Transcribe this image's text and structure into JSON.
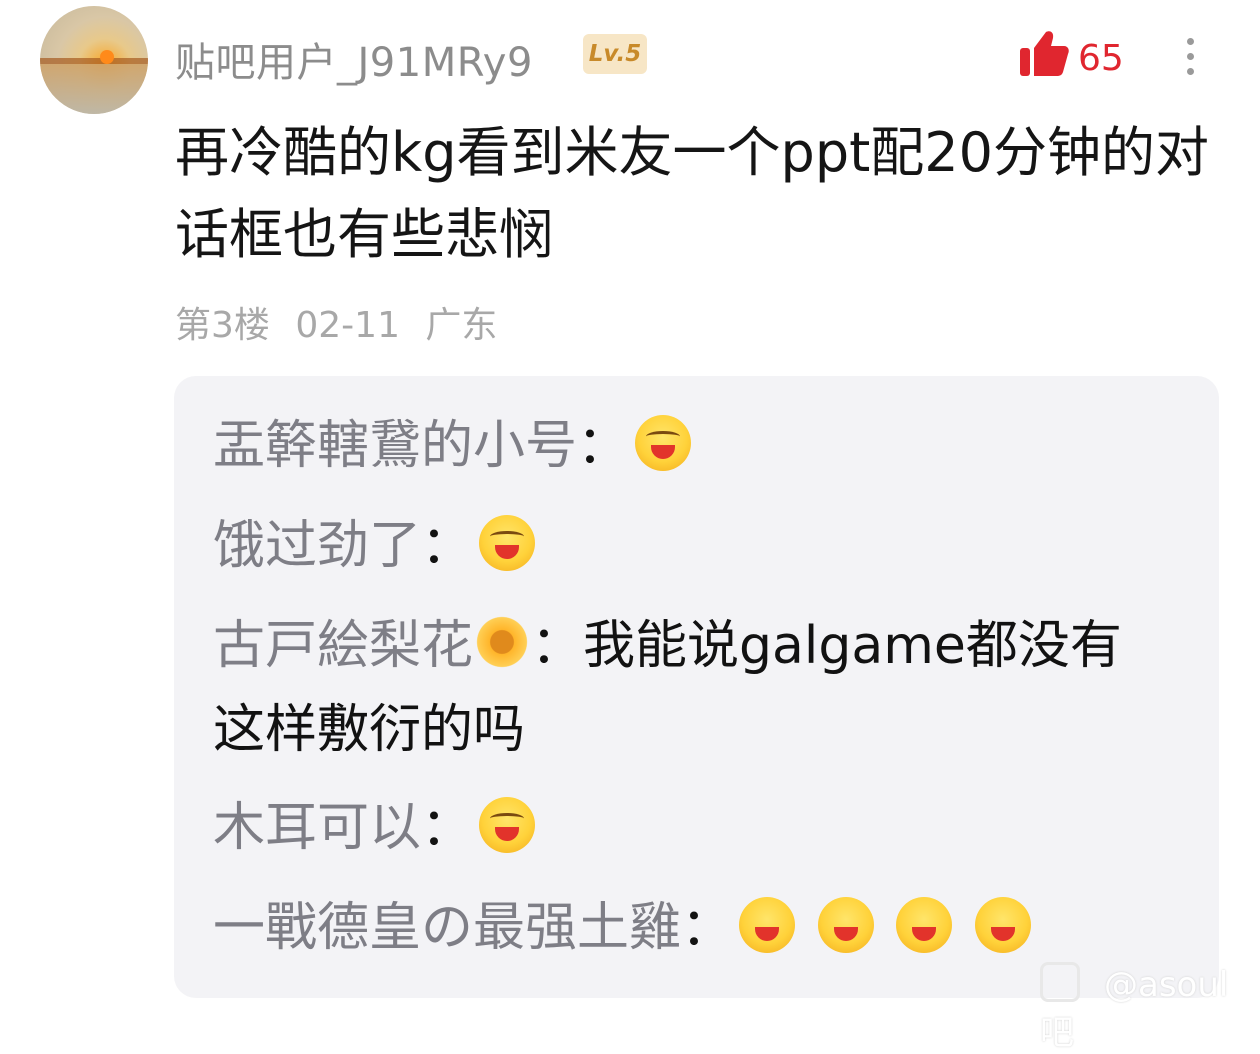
{
  "post": {
    "username": "贴吧用户_J91MRy9",
    "level": "Lv.5",
    "likes": "65",
    "text": "再冷酷的kg看到米友一个ppt配20分钟的对话框也有些悲悯",
    "floor": "第3楼",
    "date": "02-11",
    "location": "广东"
  },
  "replies": [
    {
      "name": "盂簳轄鵞的小号",
      "sep": "：",
      "text": "",
      "emoji_count": 1
    },
    {
      "name": "饿过劲了",
      "sep": "：",
      "text": "",
      "emoji_count": 1
    },
    {
      "name": "古戸絵梨花",
      "sep": "：",
      "text": "我能说galgame都没有这样敷衍的吗",
      "emoji_count": 0
    },
    {
      "name": "木耳可以",
      "sep": "：",
      "text": "",
      "emoji_count": 1
    },
    {
      "name": "一戰德皇の最强土雞",
      "sep": "：",
      "text": "",
      "emoji_count": 4
    }
  ],
  "watermark": "@asoul吧",
  "colors": {
    "like": "#e0262f",
    "level_bg": "#f7e6c6",
    "level_fg": "#c88a2a",
    "reply_bg": "#f3f3f6"
  },
  "icons": [
    "avatar-image",
    "thumbs-up-icon",
    "more-vertical-icon",
    "laughing-emoji-icon",
    "flower-emoji-icon"
  ]
}
